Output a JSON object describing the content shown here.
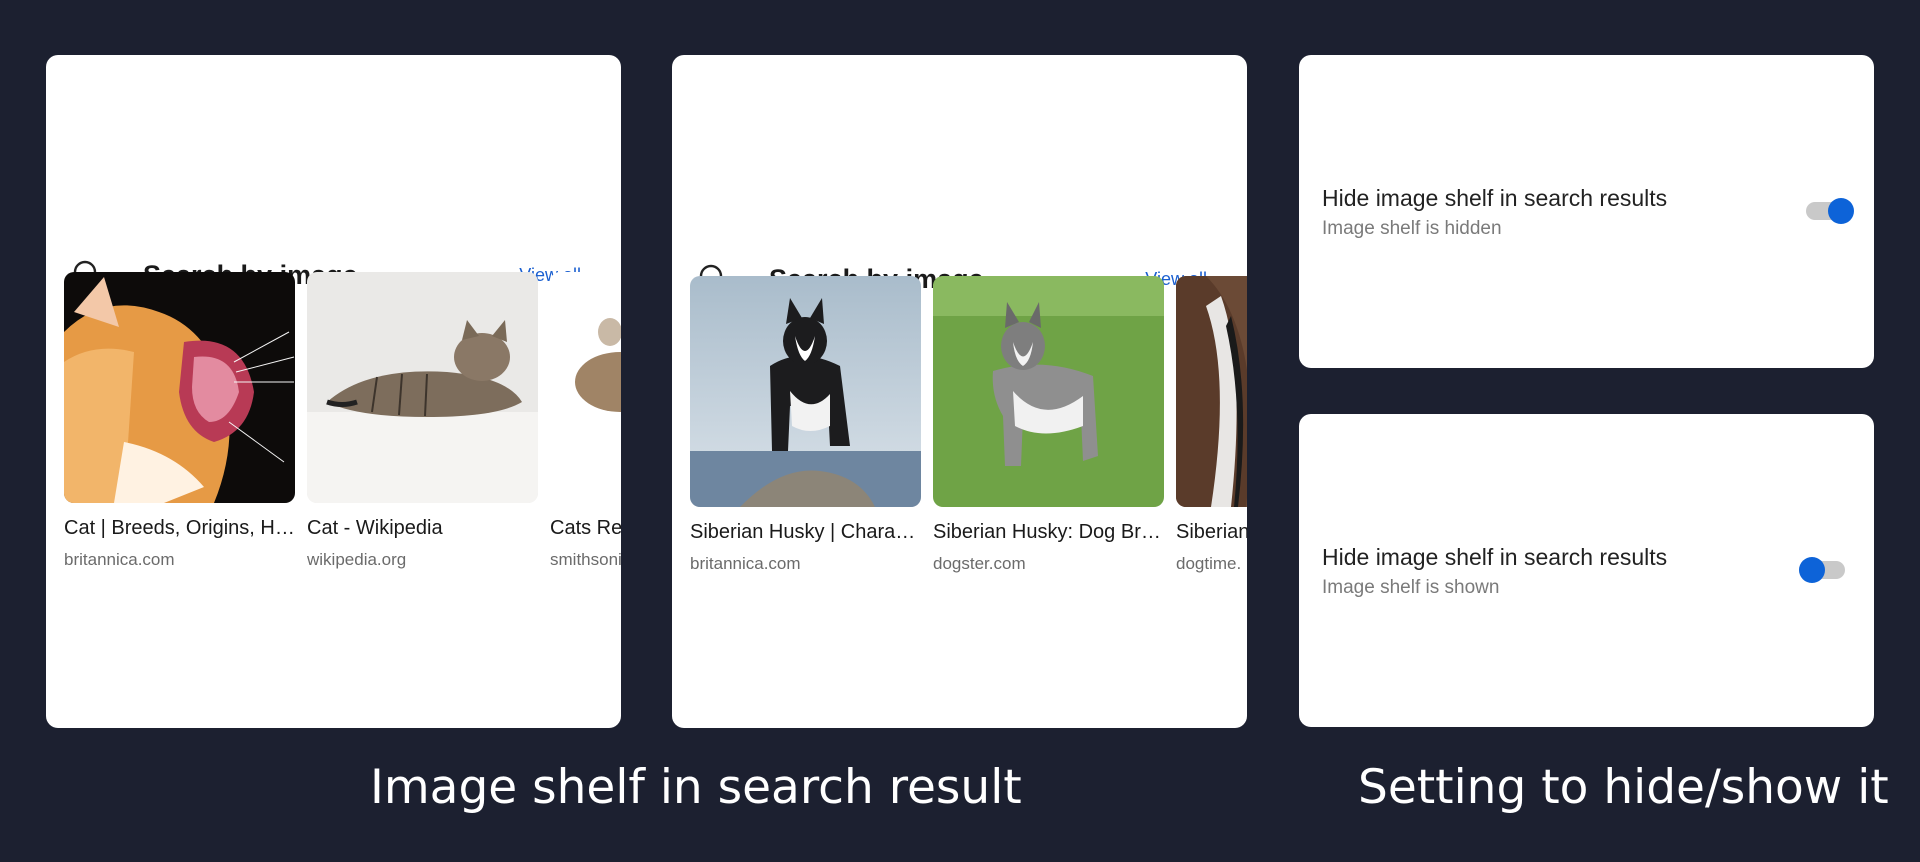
{
  "shelf_cards": [
    {
      "header": {
        "title": "Search by image",
        "view_all": "View all",
        "icon": "search-icon"
      },
      "results": [
        {
          "title": "Cat | Breeds, Origins, History, Body...",
          "source": "britannica.com"
        },
        {
          "title": "Cat - Wikipedia",
          "source": "wikipedia.org"
        },
        {
          "title": "Cats Re",
          "source": "smithsonian"
        }
      ]
    },
    {
      "header": {
        "title": "Search by image",
        "view_all": "View all",
        "icon": "search-icon"
      },
      "results": [
        {
          "title": "Siberian Husky | Characteristics...",
          "source": "britannica.com"
        },
        {
          "title": "Siberian Husky: Dog Breed...",
          "source": "dogster.com"
        },
        {
          "title": "Siberian",
          "source": "dogtime."
        }
      ]
    }
  ],
  "settings": [
    {
      "title": "Hide image shelf in search results",
      "subtitle": "Image shelf is hidden",
      "toggle_on": true
    },
    {
      "title": "Hide image shelf in search results",
      "subtitle": "Image shelf is shown",
      "toggle_on": false
    }
  ],
  "captions": {
    "left": "Image shelf in search result",
    "right": "Setting to hide/show it"
  },
  "colors": {
    "background": "#1c2030",
    "link": "#1a5fd0",
    "toggle_knob": "#0d63d8",
    "toggle_track": "#c9c9c9"
  }
}
